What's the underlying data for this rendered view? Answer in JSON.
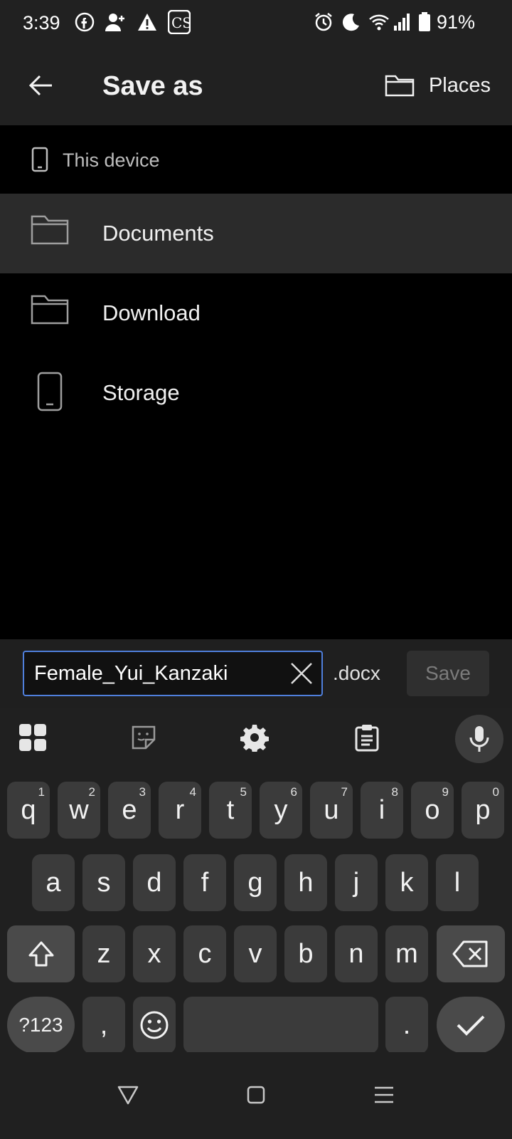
{
  "status_bar": {
    "time": "3:39",
    "battery": "91%",
    "left_icons": [
      "facebook-icon",
      "add-contact-icon",
      "warning-icon",
      "cs-app-icon"
    ],
    "right_icons": [
      "alarm-icon",
      "do-not-disturb-icon",
      "wifi-icon",
      "signal-icon",
      "battery-icon"
    ]
  },
  "app_bar": {
    "title": "Save as",
    "places_label": "Places"
  },
  "breadcrumb": {
    "label": "This device"
  },
  "folders": [
    {
      "label": "Documents",
      "icon": "folder-icon",
      "selected": true
    },
    {
      "label": "Download",
      "icon": "folder-icon",
      "selected": false
    },
    {
      "label": "Storage",
      "icon": "phone-icon",
      "selected": false
    }
  ],
  "filename_bar": {
    "value": "Female_Yui_Kanzaki",
    "extension": ".docx",
    "save_label": "Save"
  },
  "keyboard": {
    "row1": [
      {
        "k": "q",
        "h": "1"
      },
      {
        "k": "w",
        "h": "2"
      },
      {
        "k": "e",
        "h": "3"
      },
      {
        "k": "r",
        "h": "4"
      },
      {
        "k": "t",
        "h": "5"
      },
      {
        "k": "y",
        "h": "6"
      },
      {
        "k": "u",
        "h": "7"
      },
      {
        "k": "i",
        "h": "8"
      },
      {
        "k": "o",
        "h": "9"
      },
      {
        "k": "p",
        "h": "0"
      }
    ],
    "row2": [
      "a",
      "s",
      "d",
      "f",
      "g",
      "h",
      "j",
      "k",
      "l"
    ],
    "row3": [
      "z",
      "x",
      "c",
      "v",
      "b",
      "n",
      "m"
    ],
    "symbols_label": "?123",
    "comma_label": ",",
    "period_label": "."
  },
  "colors": {
    "accent": "#4f7fdc",
    "bar_bg": "#212121",
    "selected_row": "#2b2b2b"
  }
}
